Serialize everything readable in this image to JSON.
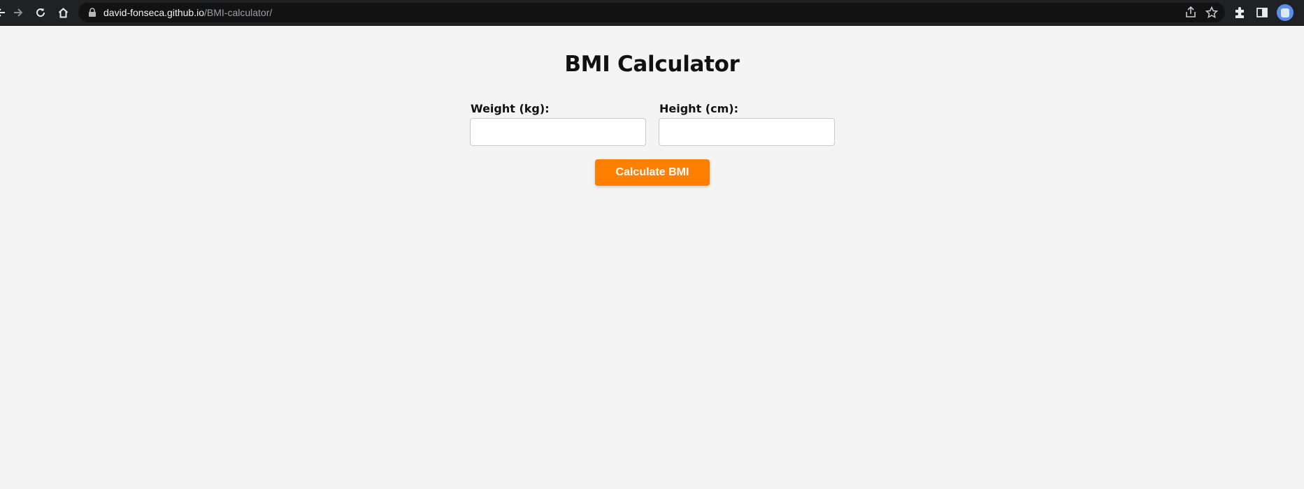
{
  "browser": {
    "url_host": "david-fonseca.github.io",
    "url_path": "/BMI-calculator/",
    "icons": [
      "back-icon",
      "forward-icon",
      "reload-icon",
      "home-icon",
      "lock-icon",
      "share-icon",
      "star-icon",
      "extensions-icon",
      "side-panel-icon",
      "profile-icon"
    ]
  },
  "page": {
    "title": "BMI Calculator",
    "weight_label": "Weight (kg):",
    "weight_value": "",
    "height_label": "Height (cm):",
    "height_value": "",
    "button_label": "Calculate BMI"
  },
  "colors": {
    "page_background": "#f4f4f4",
    "button_accent": "#ff7f00",
    "toolbar": "#202124"
  }
}
